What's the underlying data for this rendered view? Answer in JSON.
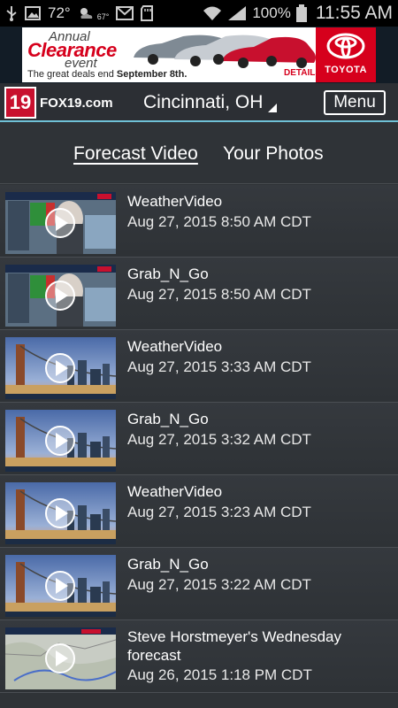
{
  "status_bar": {
    "temperature": "72°",
    "weather_small": "67°",
    "battery_percent": "100%",
    "time": "11:55 AM",
    "icons": [
      "usb-icon",
      "image-icon",
      "weather-icon",
      "gmail-icon",
      "sd-card-icon",
      "wifi-icon",
      "signal-icon",
      "battery-icon"
    ]
  },
  "ad": {
    "line_annual": "Annual",
    "line_clearance": "Clearance",
    "line_event": "event",
    "deals_prefix": "The great deals end ",
    "deals_date": "September 8th.",
    "details": "DETAILS >",
    "brand": "TOYOTA",
    "brand_color": "#d6001c"
  },
  "header": {
    "logo_number": "19",
    "logo_text": "FOX19.com",
    "location": "Cincinnati, OH",
    "menu_label": "Menu",
    "accent_color": "#6fc1d6"
  },
  "tabs": {
    "active": "Forecast Video",
    "other": "Your Photos"
  },
  "videos": [
    {
      "title": "WeatherVideo",
      "date": "Aug 27, 2015 8:50 AM CDT"
    },
    {
      "title": "Grab_N_Go",
      "date": "Aug 27, 2015 8:50 AM CDT"
    },
    {
      "title": "WeatherVideo",
      "date": "Aug 27, 2015 3:33 AM CDT"
    },
    {
      "title": "Grab_N_Go",
      "date": "Aug 27, 2015 3:32 AM CDT"
    },
    {
      "title": "WeatherVideo",
      "date": "Aug 27, 2015 3:23 AM CDT"
    },
    {
      "title": "Grab_N_Go",
      "date": "Aug 27, 2015 3:22 AM CDT"
    },
    {
      "title": "Steve Horstmeyer's Wednesday forecast",
      "date": "Aug 26, 2015 1:18 PM CDT"
    }
  ]
}
